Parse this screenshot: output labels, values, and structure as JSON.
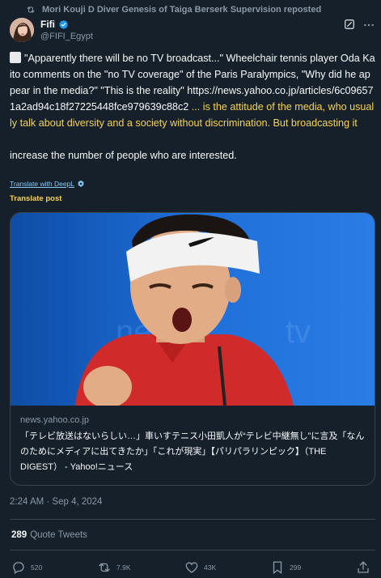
{
  "repost": {
    "text": "Mori Kouji D Diver Genesis of Taiga Berserk Supervision reposted",
    "icon": "repost-icon"
  },
  "author": {
    "name": "Fifi",
    "handle": "@FIFI_Egypt",
    "verified_color": "#1d9bf0"
  },
  "tweet": {
    "text_white_1": "\"Apparently there will be no TV broadcast...\" Wheelchair tennis player Oda Kaito comments on the \"no TV coverage\" of the Paris Paralympics, \"Why did he appear in the media?\" \"This is the reality\" https://news.yahoo.co.jp/articles/6c096571a2ad94c18f27225448fce979639c88c2",
    "text_yellow": " ... is the attitude of the media, who usually talk about diversity and a society without discrimination. But broadcasting it",
    "text_white_2": "\n\nincrease the number of people who are interested."
  },
  "translate": {
    "deepl_label": "Translate with DeepL",
    "post_label": "Translate post"
  },
  "card": {
    "domain": "news.yahoo.co.jp",
    "title": "「テレビ放送はないらしい…」車いすテニス小田凱人が“テレビ中継無し”に言及「なんのためにメディアに出てきたか」「これが現実」【パリパラリンピック】（THE DIGEST） - Yahoo!ニュース"
  },
  "meta": {
    "timestamp": "2:24 AM · Sep 4, 2024",
    "quote_count": "289",
    "quote_label": "Quote Tweets"
  },
  "actions": {
    "replies": "520",
    "reposts": "7.9K",
    "likes": "43K",
    "bookmarks": "299"
  },
  "colors": {
    "background": "#15202b",
    "highlight": "#f7d351",
    "muted": "#8b98a5",
    "border": "#38444d"
  }
}
